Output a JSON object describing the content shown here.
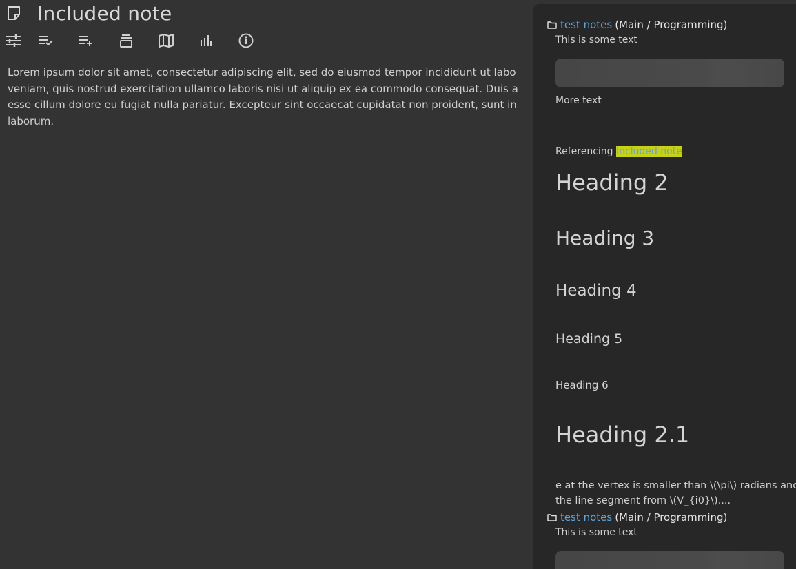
{
  "note": {
    "title": "Included note",
    "content_lines": [
      "Lorem ipsum dolor sit amet, consectetur adipiscing elit, sed do eiusmod tempor incididunt ut labo",
      "veniam, quis nostrud exercitation ullamco laboris nisi ut aliquip ex ea commodo consequat. Duis a",
      "esse cillum dolore eu fugiat nulla pariatur. Excepteur sint occaecat cupidatat non proident, sunt in",
      "laborum."
    ]
  },
  "toolbar": {
    "buttons": [
      {
        "icon": "tune-icon"
      },
      {
        "icon": "playlist-check-icon"
      },
      {
        "icon": "playlist-plus-icon"
      },
      {
        "icon": "archive-icon"
      },
      {
        "icon": "map-icon"
      },
      {
        "icon": "bar-chart-icon"
      },
      {
        "icon": "info-icon"
      }
    ]
  },
  "panel": {
    "references": [
      {
        "note_link": "test notes",
        "path": "(Main / Programming)",
        "text1": "This is some text",
        "text2": "More text",
        "referencing_prefix": "Referencing ",
        "referencing_link": "Included note",
        "headings": {
          "h2": "Heading 2",
          "h3": "Heading 3",
          "h4": "Heading 4",
          "h5": "Heading 5",
          "h6": "Heading 6",
          "h21": "Heading 2.1"
        },
        "excerpt_line1": "e at the vertex is smaller than \\(\\pi\\) radians and",
        "excerpt_line2": "the line segment from \\(V_{i0}\\)...."
      },
      {
        "note_link": "test notes",
        "path": "(Main / Programming)",
        "text1": "This is some text"
      }
    ]
  },
  "colors": {
    "background": "#333333",
    "panel": "#272727",
    "accent": "#5aa6dd",
    "highlight": "#c6d21a"
  }
}
